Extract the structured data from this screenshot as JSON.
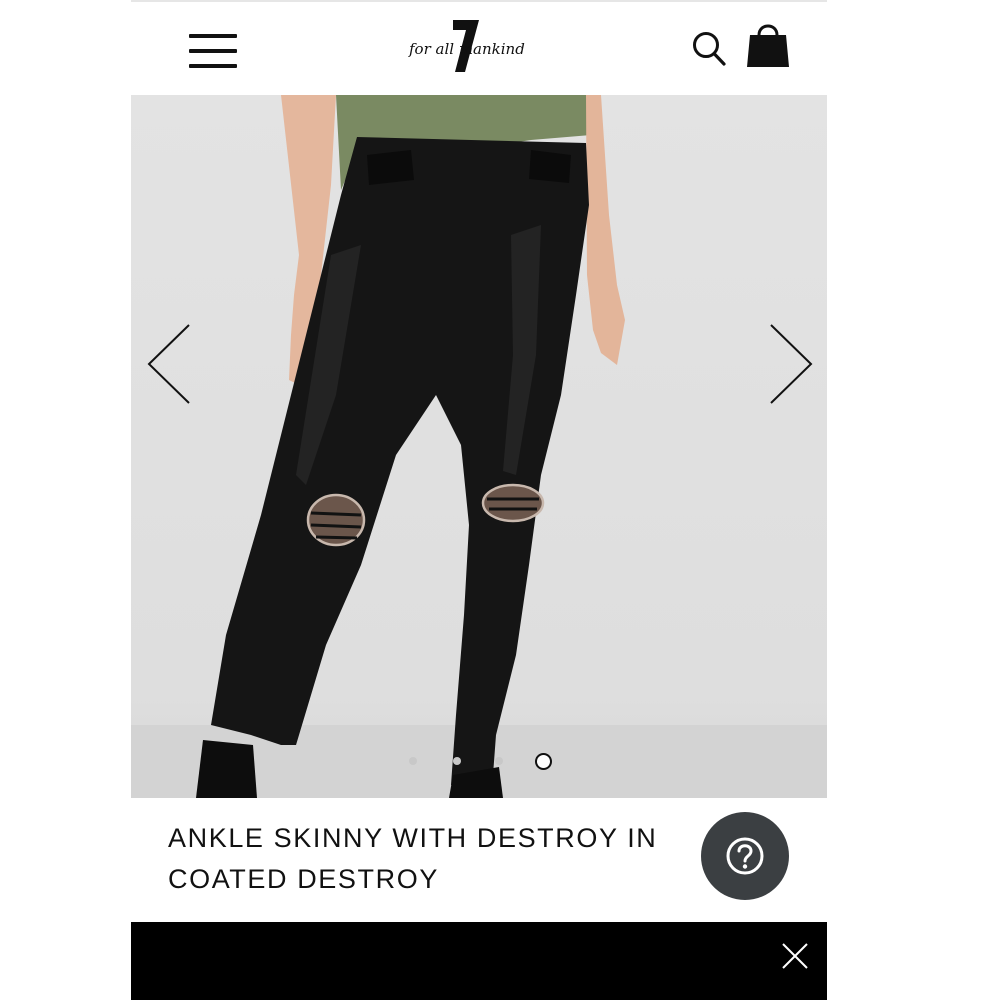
{
  "header": {
    "brand": "for all mankind",
    "brand_mark": "7",
    "icons": {
      "menu": "hamburger-menu-icon",
      "search": "search-icon",
      "bag": "shopping-bag-icon"
    }
  },
  "gallery": {
    "image_count": 4,
    "active_index": 3,
    "icons": {
      "prev": "chevron-left-icon",
      "next": "chevron-right-icon"
    }
  },
  "product": {
    "title": "ANKLE SKINNY WITH DESTROY IN COATED DESTROY"
  },
  "help": {
    "icon": "question-mark-icon",
    "color": "#3b3f42"
  },
  "promo_bar": {
    "icon": "close-icon",
    "color": "#000000"
  }
}
